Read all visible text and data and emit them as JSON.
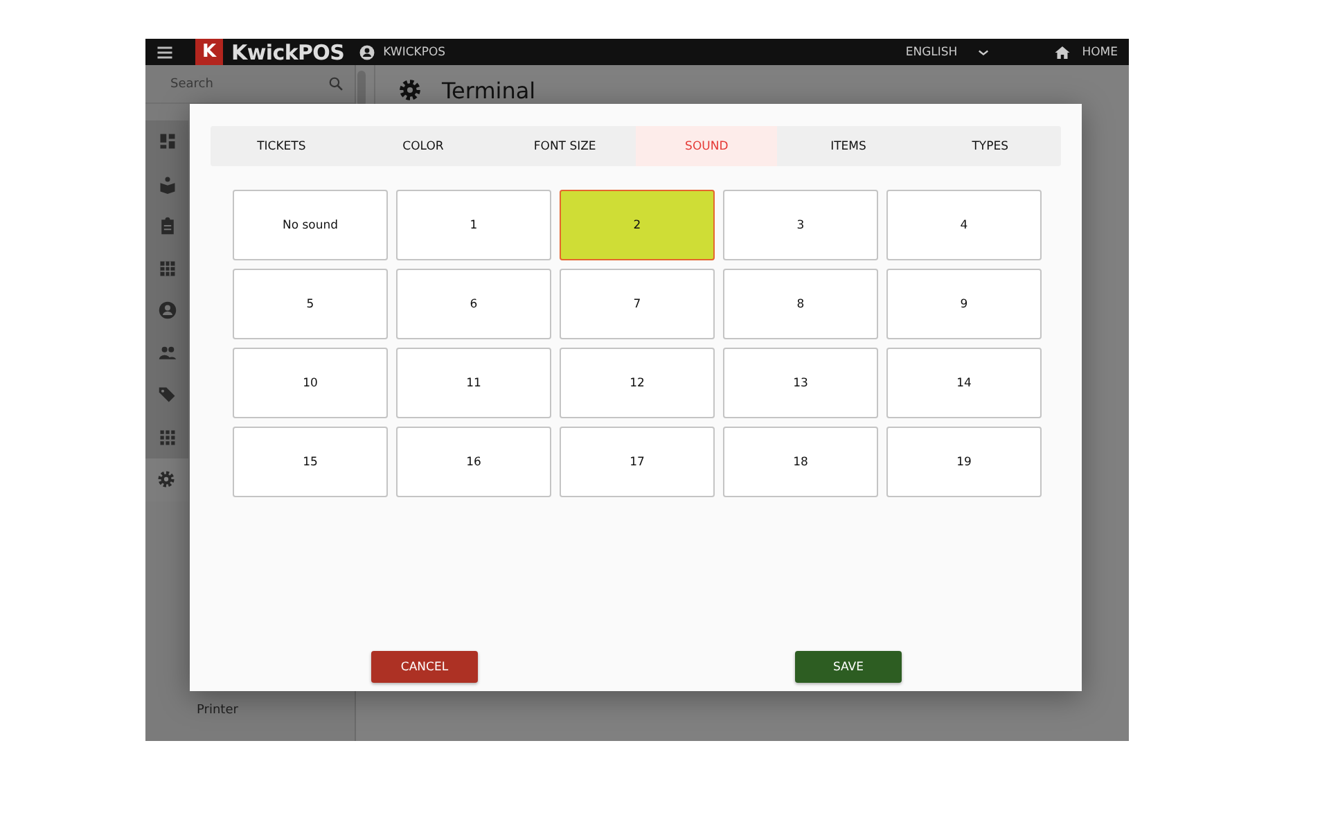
{
  "top_bar": {
    "logo_mark": "K",
    "logo": "KwickPOS",
    "account": "KWICKPOS",
    "language": "ENGLISH",
    "home": "HOME"
  },
  "sidebar": {
    "search": {
      "placeholder": "Search"
    },
    "nav_icons": [
      {
        "kind": "dashboard",
        "selected": false
      },
      {
        "kind": "reader",
        "selected": false
      },
      {
        "kind": "clipboard",
        "selected": false
      },
      {
        "kind": "table",
        "selected": false
      },
      {
        "kind": "account",
        "selected": false
      },
      {
        "kind": "people",
        "selected": false
      },
      {
        "kind": "tags",
        "selected": false
      },
      {
        "kind": "apps",
        "selected": false
      },
      {
        "kind": "settings",
        "selected": true
      }
    ],
    "items": [
      {
        "label": "Printer"
      }
    ]
  },
  "page": {
    "title": "Terminal"
  },
  "dialog": {
    "tabs": [
      {
        "label": "TICKETS",
        "selected": false
      },
      {
        "label": "COLOR",
        "selected": false
      },
      {
        "label": "FONT SIZE",
        "selected": false
      },
      {
        "label": "SOUND",
        "selected": true
      },
      {
        "label": "ITEMS",
        "selected": false
      },
      {
        "label": "TYPES",
        "selected": false
      }
    ],
    "options": [
      {
        "label": "No sound",
        "selected": false
      },
      {
        "label": "1",
        "selected": false
      },
      {
        "label": "2",
        "selected": true
      },
      {
        "label": "3",
        "selected": false
      },
      {
        "label": "4",
        "selected": false
      },
      {
        "label": "5",
        "selected": false
      },
      {
        "label": "6",
        "selected": false
      },
      {
        "label": "7",
        "selected": false
      },
      {
        "label": "8",
        "selected": false
      },
      {
        "label": "9",
        "selected": false
      },
      {
        "label": "10",
        "selected": false
      },
      {
        "label": "11",
        "selected": false
      },
      {
        "label": "12",
        "selected": false
      },
      {
        "label": "13",
        "selected": false
      },
      {
        "label": "14",
        "selected": false
      },
      {
        "label": "15",
        "selected": false
      },
      {
        "label": "16",
        "selected": false
      },
      {
        "label": "17",
        "selected": false
      },
      {
        "label": "18",
        "selected": false
      },
      {
        "label": "19",
        "selected": false
      }
    ],
    "buttons": [
      {
        "label": "CANCEL",
        "kind": "cancel"
      },
      {
        "label": "SAVE",
        "kind": "save"
      }
    ]
  }
}
